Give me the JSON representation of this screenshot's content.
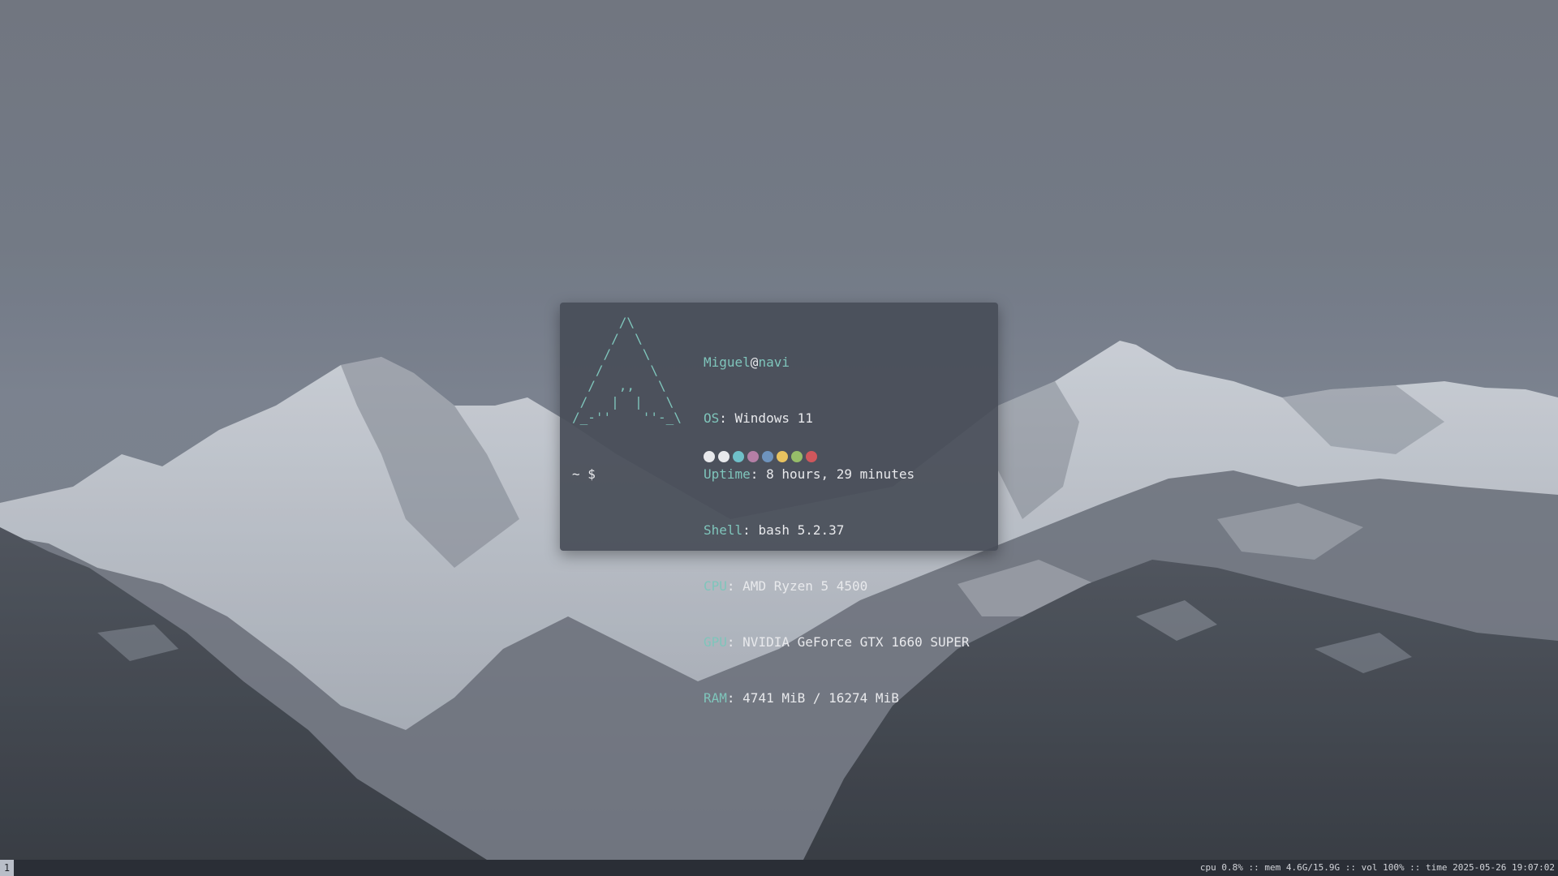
{
  "terminal": {
    "ascii_art": "      /\\\n     /  \\\n    /    \\\n   /      \\\n  /   ,,   \\\n /   |  |   \\\n/_-''    ''-_\\",
    "user": "Miguel",
    "at": "@",
    "host": "navi",
    "info": [
      {
        "key": "OS",
        "value": "Windows 11"
      },
      {
        "key": "Uptime",
        "value": "8 hours, 29 minutes"
      },
      {
        "key": "Shell",
        "value": "bash 5.2.37"
      },
      {
        "key": "CPU",
        "value": "AMD Ryzen 5 4500"
      },
      {
        "key": "GPU",
        "value": "NVIDIA GeForce GTX 1660 SUPER"
      },
      {
        "key": "RAM",
        "value": "4741 MiB / 16274 MiB"
      }
    ],
    "separator": ": ",
    "palette": [
      "#e8e9ec",
      "#e8e9ec",
      "#6fc0c9",
      "#b47fa6",
      "#6e93bd",
      "#e8c25f",
      "#96bd69",
      "#d0575c"
    ],
    "prompt": "~ $"
  },
  "statusbar": {
    "workspace": "1",
    "status": "cpu 0.8% :: mem 4.6G/15.9G :: vol 100% :: time 2025-05-26 19:07:02"
  },
  "colors": {
    "accent": "#7fc5bb",
    "terminal_bg": "#484d58",
    "bar_bg": "#2a2e36"
  }
}
